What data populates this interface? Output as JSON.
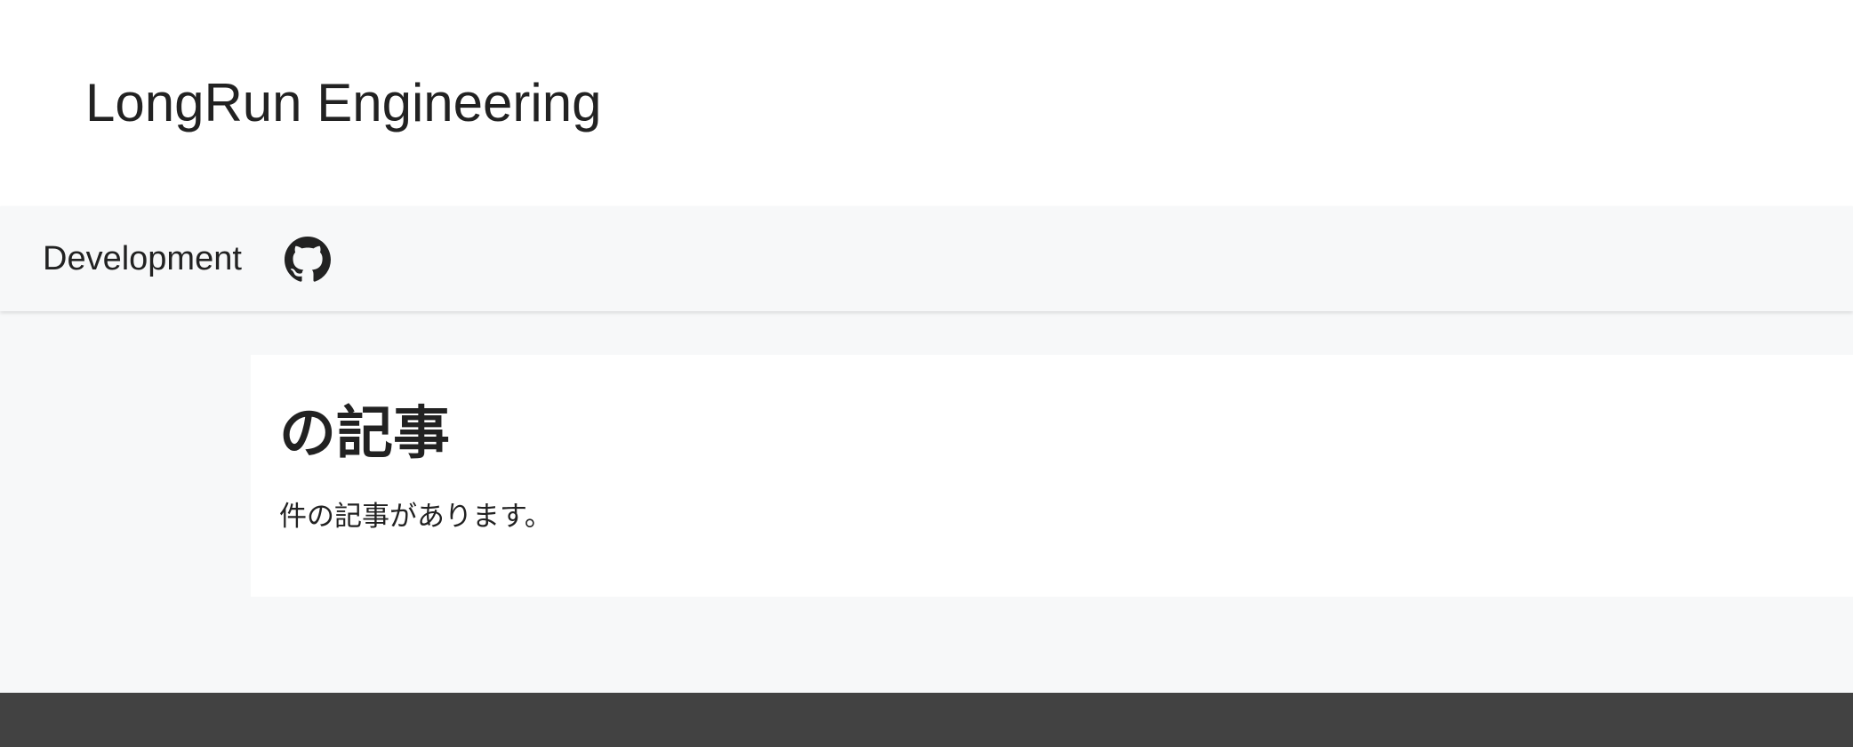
{
  "header": {
    "site_title": "LongRun Engineering"
  },
  "nav": {
    "items": [
      {
        "label": "Development"
      }
    ],
    "github_icon": "github-icon"
  },
  "main": {
    "heading": "の記事",
    "count_text": "件の記事があります。"
  },
  "colors": {
    "page_background": "#f7f8f9",
    "card_background": "#ffffff",
    "footer_background": "#424242",
    "text": "#222222"
  }
}
